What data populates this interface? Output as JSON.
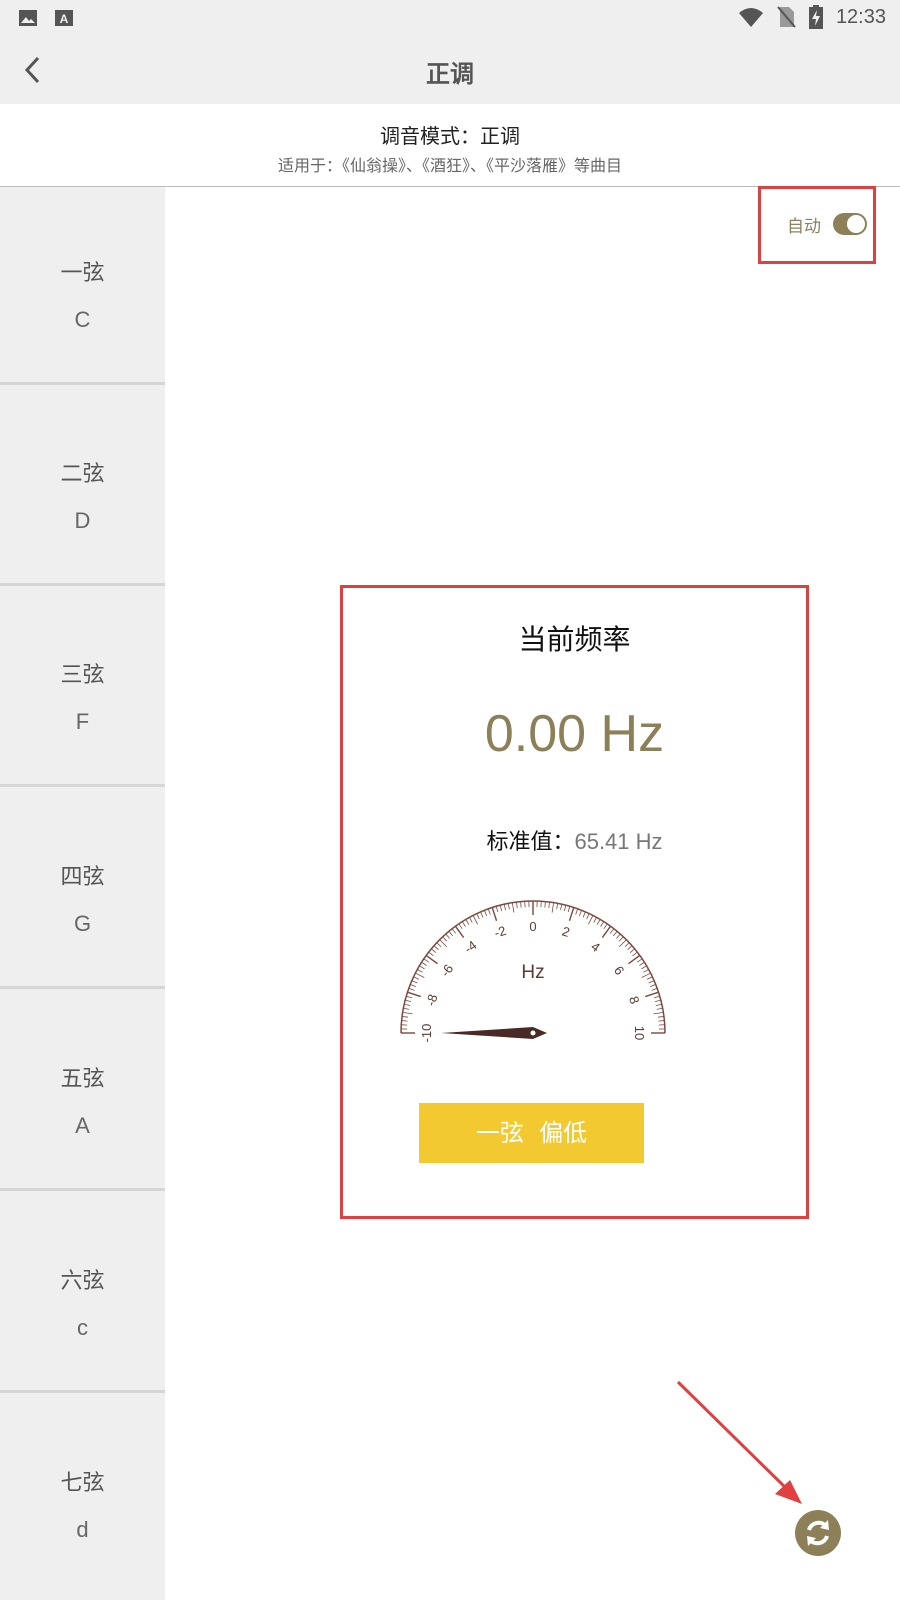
{
  "status_bar": {
    "time": "12:33",
    "icons": [
      "image-icon",
      "a-letter-icon",
      "wifi-icon",
      "no-sim-icon",
      "battery-charging-icon"
    ]
  },
  "app_bar": {
    "title": "正调",
    "back_icon": "chevron-left-icon"
  },
  "mode": {
    "label": "调音模式：正调",
    "suitable": "适用于：《仙翁操》、《酒狂》、《平沙落雁》等曲目"
  },
  "strings": [
    {
      "name": "一弦",
      "note": "C"
    },
    {
      "name": "二弦",
      "note": "D"
    },
    {
      "name": "三弦",
      "note": "F"
    },
    {
      "name": "四弦",
      "note": "G"
    },
    {
      "name": "五弦",
      "note": "A"
    },
    {
      "name": "六弦",
      "note": "c"
    },
    {
      "name": "七弦",
      "note": "d"
    }
  ],
  "auto": {
    "label": "自动",
    "enabled": true
  },
  "tuner": {
    "heading": "当前频率",
    "frequency": "0.00 Hz",
    "standard_label": "标准值：",
    "standard_value": "65.41 Hz",
    "gauge_unit": "Hz",
    "gauge_ticks": [
      "-10",
      "-8",
      "-6",
      "-4",
      "-2",
      "0",
      "2",
      "4",
      "6",
      "8",
      "10"
    ],
    "needle_value": -10,
    "status_text": "一弦  偏低"
  },
  "refresh_icon": "refresh-icon",
  "colors": {
    "accent": "#8d8058",
    "status_button": "#f2c930",
    "highlight": "#e04040",
    "gauge": "#7a4a40"
  }
}
